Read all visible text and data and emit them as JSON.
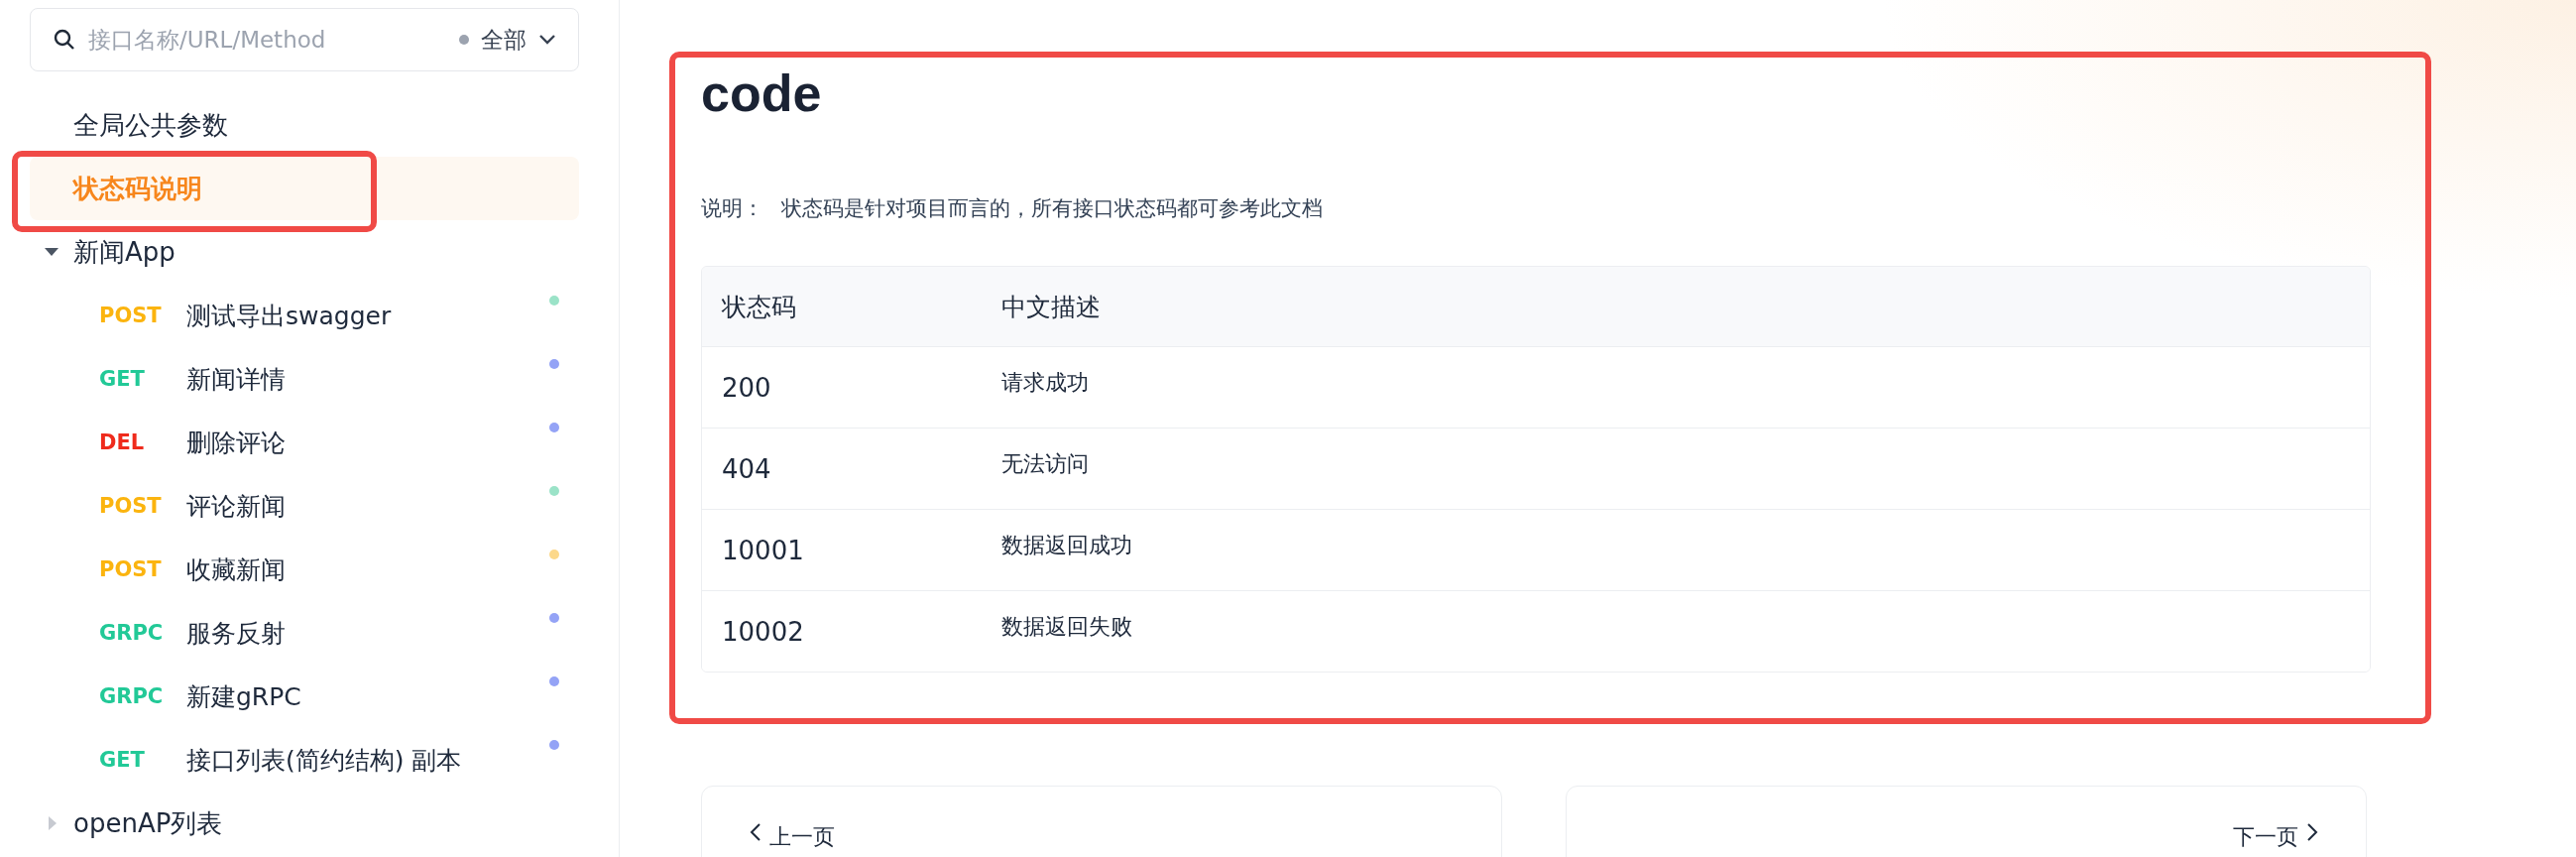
{
  "sidebar": {
    "search": {
      "placeholder": "接口名称/URL/Method",
      "filter": "全部"
    },
    "items": [
      {
        "label": "全局公共参数",
        "selected": false,
        "annotated": false
      },
      {
        "label": "状态码说明",
        "selected": true,
        "annotated": true
      }
    ],
    "tree": [
      {
        "label": "新闻App",
        "expanded": true,
        "children": [
          {
            "method": "POST",
            "kind": "post",
            "label": "测试导出swagger",
            "color": "#9be3c8"
          },
          {
            "method": "GET",
            "kind": "get",
            "label": "新闻详情",
            "color": "#94a3f6"
          },
          {
            "method": "DEL",
            "kind": "del",
            "label": "删除评论",
            "color": "#94a3f6"
          },
          {
            "method": "POST",
            "kind": "post",
            "label": "评论新闻",
            "color": "#9be3c8"
          },
          {
            "method": "POST",
            "kind": "post",
            "label": "收藏新闻",
            "color": "#fcd88a"
          },
          {
            "method": "GRPC",
            "kind": "grpc",
            "label": "服务反射",
            "color": "#94a3f6"
          },
          {
            "method": "GRPC",
            "kind": "grpc",
            "label": "新建gRPC",
            "color": "#94a3f6"
          },
          {
            "method": "GET",
            "kind": "get",
            "label": "接口列表(简约结构) 副本",
            "color": "#94a3f6"
          }
        ]
      },
      {
        "label": "openAP列表",
        "expanded": false
      }
    ]
  },
  "main": {
    "annotated": true,
    "title": "code",
    "description_label": "说明：",
    "description": "状态码是针对项目而言的，所有接口状态码都可参考此文档",
    "table": {
      "columns": [
        "状态码",
        "中文描述"
      ],
      "rows": [
        [
          "200",
          "请求成功"
        ],
        [
          "404",
          "无法访问"
        ],
        [
          "10001",
          "数据返回成功"
        ],
        [
          "10002",
          "数据返回失败"
        ]
      ]
    },
    "pager": {
      "prev": "上一页",
      "next": "下一页"
    }
  }
}
